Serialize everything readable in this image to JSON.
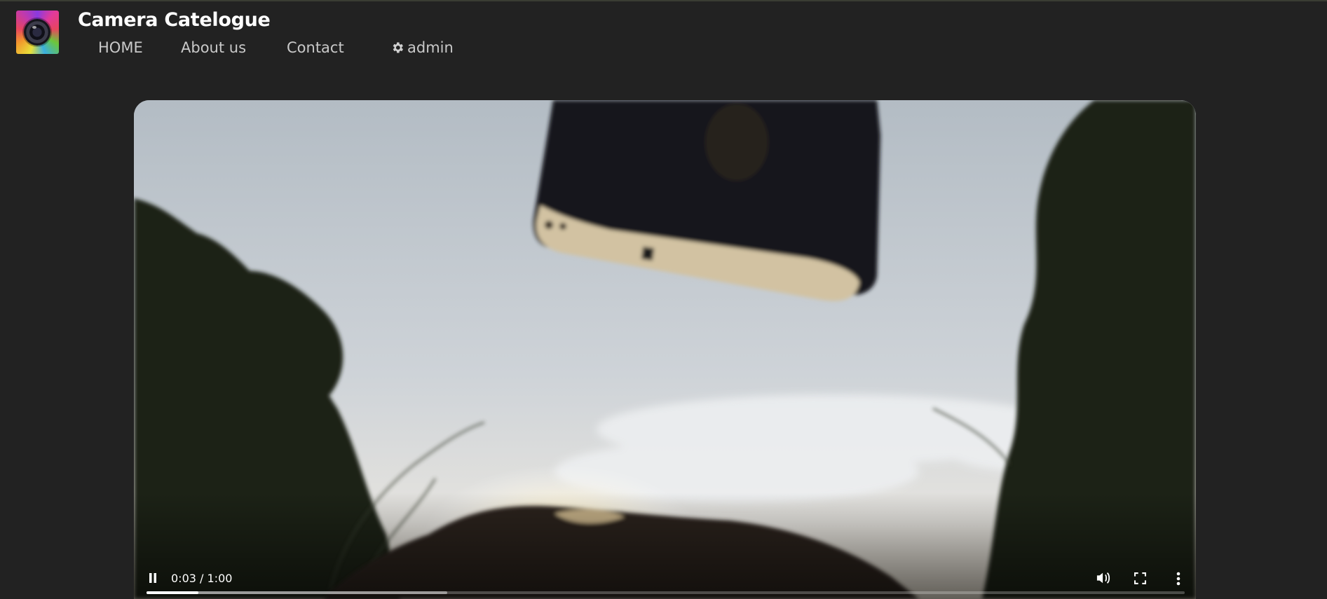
{
  "header": {
    "brand": "Camera Catelogue",
    "logo_icon": "camera-lens-icon"
  },
  "nav": {
    "items": [
      {
        "label": "HOME"
      },
      {
        "label": "About us"
      },
      {
        "label": "Contact"
      },
      {
        "label": "admin",
        "icon": "gear-icon"
      }
    ]
  },
  "video": {
    "current_time": "0:03",
    "duration": "1:00",
    "time_display": "0:03 / 1:00",
    "played_fraction": 0.05,
    "buffered_fraction": 0.29,
    "icons": {
      "play_pause": "pause-icon",
      "volume": "volume-icon",
      "fullscreen": "fullscreen-icon",
      "more": "more-vertical-icon"
    }
  },
  "colors": {
    "background": "#222222",
    "brand_text": "#ffffff",
    "nav_text": "#c9c9c9"
  }
}
